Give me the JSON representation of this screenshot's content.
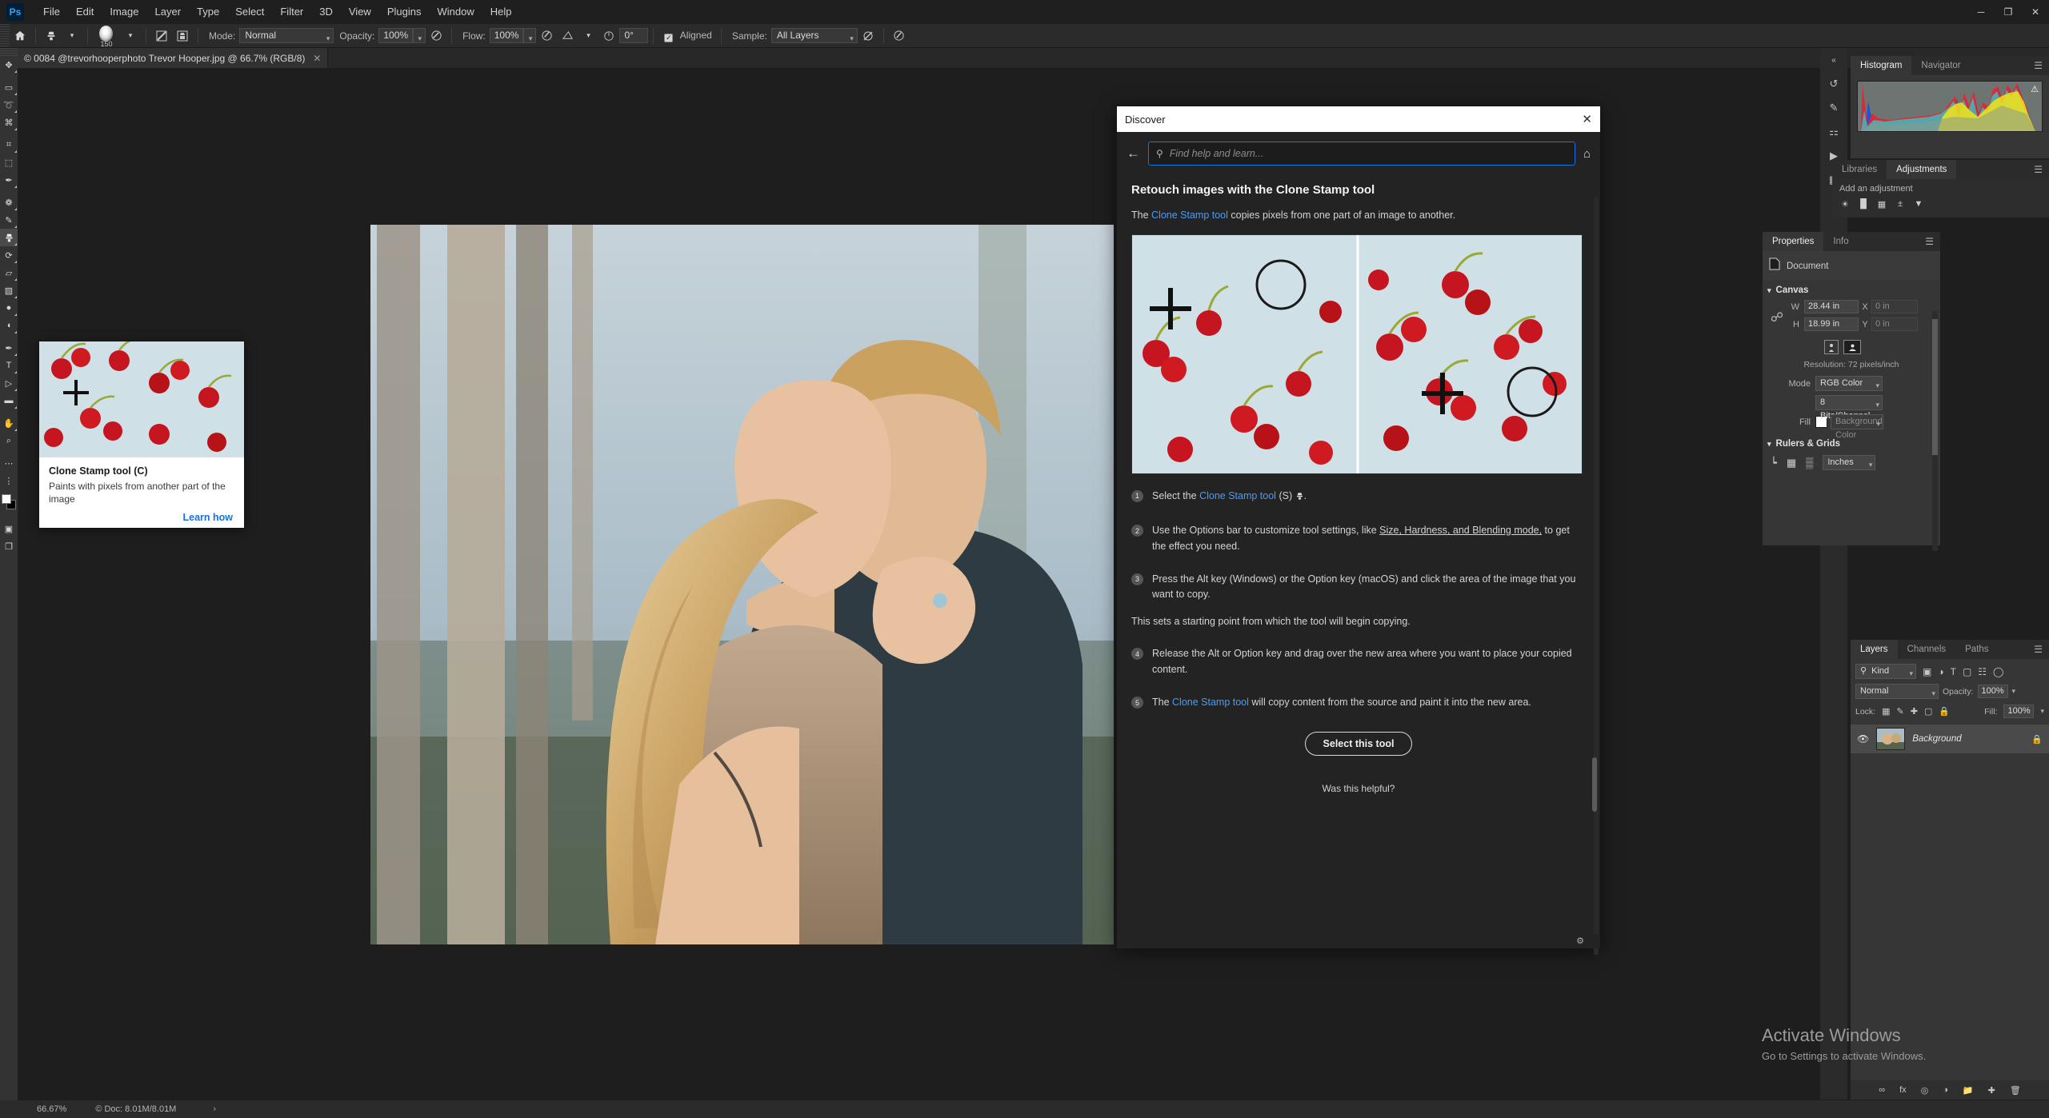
{
  "app": {
    "name": "Adobe Photoshop",
    "logo_text": "Ps"
  },
  "menubar": {
    "items": [
      "File",
      "Edit",
      "Image",
      "Layer",
      "Type",
      "Select",
      "Filter",
      "3D",
      "View",
      "Plugins",
      "Window",
      "Help"
    ],
    "window_controls": {
      "minimize": "─",
      "maximize": "❐",
      "close": "✕"
    }
  },
  "options_bar": {
    "home_icon": "home-icon",
    "tool_icon": "clone-stamp-icon",
    "brush_size": "150",
    "mode_label": "Mode:",
    "mode_value": "Normal",
    "opacity_label": "Opacity:",
    "opacity_value": "100%",
    "flow_label": "Flow:",
    "flow_value": "100%",
    "angle_value": "0°",
    "aligned_label": "Aligned",
    "aligned_checked": true,
    "sample_label": "Sample:",
    "sample_value": "All Layers"
  },
  "document_tab": {
    "title": "© 0084 @trevorhooperphoto Trevor Hooper.jpg @ 66.7% (RGB/8)",
    "close": "✕"
  },
  "toolbar": {
    "tools": [
      {
        "name": "move-tool",
        "glyph": "✥"
      },
      {
        "name": "rectangular-marquee-tool",
        "glyph": "▭"
      },
      {
        "name": "lasso-tool",
        "glyph": "➰"
      },
      {
        "name": "object-selection-tool",
        "glyph": "⌘"
      },
      {
        "name": "crop-tool",
        "glyph": "⌗"
      },
      {
        "name": "frame-tool",
        "glyph": "⬚"
      },
      {
        "name": "eyedropper-tool",
        "glyph": "✒"
      },
      {
        "name": "spot-healing-brush-tool",
        "glyph": "❁"
      },
      {
        "name": "brush-tool",
        "glyph": "✎"
      },
      {
        "name": "clone-stamp-tool",
        "glyph": "⬤"
      },
      {
        "name": "history-brush-tool",
        "glyph": "⟳"
      },
      {
        "name": "eraser-tool",
        "glyph": "▱"
      },
      {
        "name": "gradient-tool",
        "glyph": "▨"
      },
      {
        "name": "blur-tool",
        "glyph": "●"
      },
      {
        "name": "dodge-tool",
        "glyph": "◖"
      },
      {
        "name": "pen-tool",
        "glyph": "✒"
      },
      {
        "name": "type-tool",
        "glyph": "T"
      },
      {
        "name": "path-selection-tool",
        "glyph": "▷"
      },
      {
        "name": "rectangle-tool",
        "glyph": "▬"
      },
      {
        "name": "hand-tool",
        "glyph": "✋"
      },
      {
        "name": "zoom-tool",
        "glyph": "⌕"
      },
      {
        "name": "more-tools",
        "glyph": "⋯"
      },
      {
        "name": "edit-toolbar",
        "glyph": "⋮"
      }
    ],
    "quick-mask": "▣",
    "screen-mode": "❐"
  },
  "tooltip": {
    "title": "Clone Stamp tool (C)",
    "description": "Paints with pixels from another part of the image",
    "link": "Learn how"
  },
  "discover": {
    "window_title": "Discover",
    "close": "✕",
    "back_icon": "back-arrow-icon",
    "home_icon": "home-icon",
    "search_icon": "search-icon",
    "search_placeholder": "Find help and learn...",
    "search_value": "",
    "heading": "Retouch images with the Clone Stamp tool",
    "intro_pre": "The ",
    "intro_link": "Clone Stamp tool",
    "intro_post": " copies pixels from one part of an image to another.",
    "steps": [
      {
        "num": "1",
        "pre": "Select the ",
        "link": "Clone Stamp tool",
        "post": " (S) ",
        "suffix": "."
      },
      {
        "num": "2",
        "pre": "Use the Options bar to customize tool settings, like ",
        "underline": "Size, Hardness, and Blending mode,",
        "post": " to get the effect you need."
      },
      {
        "num": "3",
        "pre": "Press the Alt key (Windows) or the Option key (macOS) and click the area of the image that you want to copy.",
        "post": ""
      },
      {
        "num": "4",
        "pre": "Release the Alt or Option key and drag over the new area where you want to place your copied content.",
        "post": ""
      },
      {
        "num": "5",
        "pre": "The ",
        "link": "Clone Stamp tool",
        "post": " will copy content from the source and paint it into the new area."
      }
    ],
    "note": "This sets a starting point from which the tool will begin copying.",
    "button": "Select this tool",
    "feedback": "Was this helpful?",
    "settings_icon": "gear-icon"
  },
  "histogram_panel": {
    "tabs": [
      {
        "label": "Histogram",
        "active": true
      },
      {
        "label": "Navigator",
        "active": false
      }
    ],
    "menu_icon": "panel-menu-icon",
    "warning_icon": "warning-icon"
  },
  "adjustments_panel": {
    "tabs": [
      {
        "label": "Libraries",
        "active": false
      },
      {
        "label": "Adjustments",
        "active": true
      }
    ],
    "menu_icon": "panel-menu-icon",
    "title": "Add an adjustment",
    "icons": [
      "brightness-contrast-icon",
      "levels-icon",
      "curves-icon",
      "exposure-icon",
      "vibrance-icon"
    ]
  },
  "properties_panel": {
    "tabs": [
      {
        "label": "Properties",
        "active": true
      },
      {
        "label": "Info",
        "active": false
      }
    ],
    "menu_icon": "panel-menu-icon",
    "doc_label": "Document",
    "canvas_section": "Canvas",
    "w_label": "W",
    "w_value": "28.44 in",
    "h_label": "H",
    "h_value": "18.99 in",
    "x_label": "X",
    "x_value": "0 in",
    "y_label": "Y",
    "y_value": "0 in",
    "resolution": "Resolution: 72 pixels/inch",
    "mode_label": "Mode",
    "mode_value": "RGB Color",
    "depth_value": "8 Bits/Channel",
    "fill_label": "Fill",
    "fill_value": "Background Color",
    "rulers_section": "Rulers & Grids",
    "units_value": "Inches",
    "link_icon": "link-icon",
    "portrait_icon": "portrait-orientation-icon",
    "landscape_icon": "landscape-orientation-icon"
  },
  "layers_panel": {
    "tabs": [
      {
        "label": "Layers",
        "active": true
      },
      {
        "label": "Channels",
        "active": false
      },
      {
        "label": "Paths",
        "active": false
      }
    ],
    "menu_icon": "panel-menu-icon",
    "filter_value": "Kind",
    "filter_icons": [
      "pixel-filter-icon",
      "adjustment-filter-icon",
      "type-filter-icon",
      "shape-filter-icon",
      "smart-object-filter-icon"
    ],
    "toggle_icon": "filter-toggle-icon",
    "blend_mode": "Normal",
    "opacity_label": "Opacity:",
    "opacity_value": "100%",
    "lock_label": "Lock:",
    "lock_icons": [
      "lock-transparency-icon",
      "lock-image-icon",
      "lock-position-icon",
      "lock-artboard-icon",
      "lock-all-icon"
    ],
    "fill_label": "Fill:",
    "fill_value": "100%",
    "layers": [
      {
        "name": "Background",
        "visible": true,
        "locked": true,
        "eye_icon": "eye-icon",
        "lock_icon": "lock-icon"
      }
    ],
    "footer_icons": [
      "link-layers-icon",
      "fx-icon",
      "mask-icon",
      "adjustment-icon",
      "group-icon",
      "new-layer-icon",
      "delete-layer-icon"
    ]
  },
  "status_bar": {
    "zoom": "66.67%",
    "doc_info": "© Doc: 8.01M/8.01M",
    "arrow": "›"
  },
  "watermark": {
    "line1": "Activate Windows",
    "line2": "Go to Settings to activate Windows."
  },
  "colors": {
    "accent_blue": "#1473e6",
    "link_blue": "#4b9cf5",
    "panel_bg": "#363636",
    "app_bg": "#1e1e1e",
    "toolbar_bg": "#333333",
    "cherry_red": "#c0141a"
  }
}
